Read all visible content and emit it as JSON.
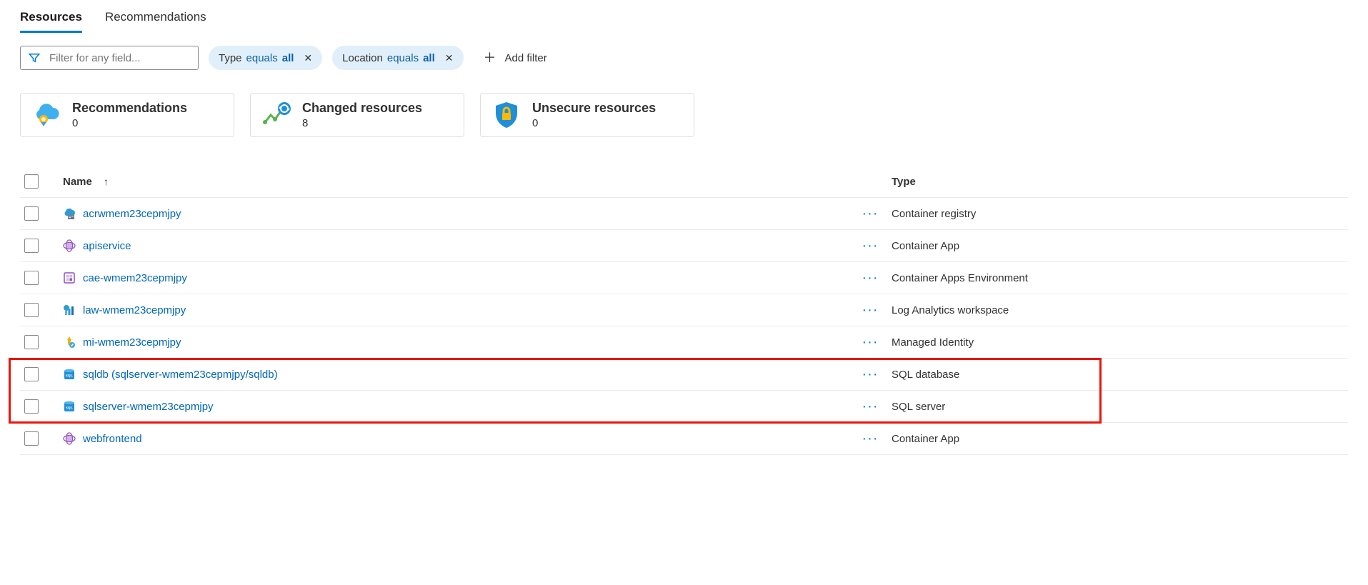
{
  "tabs": [
    {
      "label": "Resources",
      "active": true
    },
    {
      "label": "Recommendations",
      "active": false
    }
  ],
  "filter": {
    "placeholder": "Filter for any field..."
  },
  "pills": [
    {
      "prefix": "Type",
      "op": "equals",
      "val": "all"
    },
    {
      "prefix": "Location",
      "op": "equals",
      "val": "all"
    }
  ],
  "add_filter_label": "Add filter",
  "tiles": {
    "recommendations": {
      "title": "Recommendations",
      "count": "0"
    },
    "changed": {
      "title": "Changed resources",
      "count": "8"
    },
    "unsecure": {
      "title": "Unsecure resources",
      "count": "0"
    }
  },
  "columns": {
    "name": "Name",
    "type": "Type"
  },
  "rows": [
    {
      "name": "acrwmem23cepmjpy",
      "type": "Container registry",
      "icon": "acr"
    },
    {
      "name": "apiservice",
      "type": "Container App",
      "icon": "capp"
    },
    {
      "name": "cae-wmem23cepmjpy",
      "type": "Container Apps Environment",
      "icon": "cae"
    },
    {
      "name": "law-wmem23cepmjpy",
      "type": "Log Analytics workspace",
      "icon": "law"
    },
    {
      "name": "mi-wmem23cepmjpy",
      "type": "Managed Identity",
      "icon": "mi"
    },
    {
      "name": "sqldb (sqlserver-wmem23cepmjpy/sqldb)",
      "type": "SQL database",
      "icon": "sql",
      "hl": true
    },
    {
      "name": "sqlserver-wmem23cepmjpy",
      "type": "SQL server",
      "icon": "sql",
      "hl": true
    },
    {
      "name": "webfrontend",
      "type": "Container App",
      "icon": "capp"
    }
  ]
}
